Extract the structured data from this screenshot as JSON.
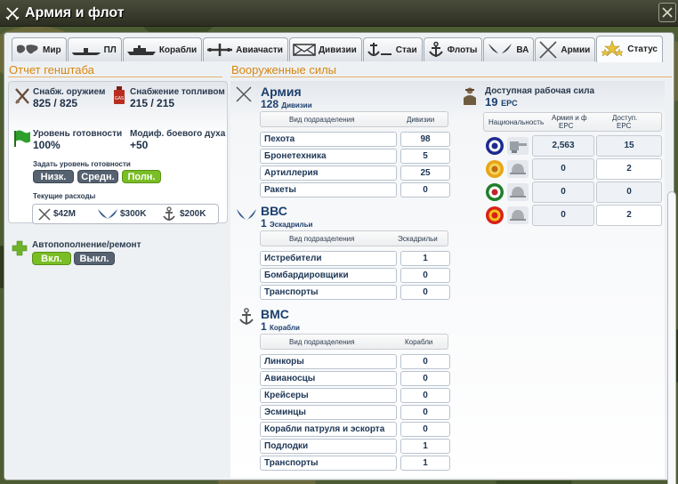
{
  "window": {
    "title": "Армия и флот",
    "close_icon": "close-icon"
  },
  "tabs": [
    {
      "label": "Мир",
      "icon": "world-map-icon"
    },
    {
      "label": "ПЛ",
      "icon": "submarine-icon"
    },
    {
      "label": "Корабли",
      "icon": "warship-icon"
    },
    {
      "label": "Авиачасти",
      "icon": "airplane-icon"
    },
    {
      "label": "Дивизии",
      "icon": "envelope-icon"
    },
    {
      "label": "Стаи",
      "icon": "anchor-fleet-icon"
    },
    {
      "label": "Флоты",
      "icon": "anchor-icon"
    },
    {
      "label": "ВА",
      "icon": "wings-icon"
    },
    {
      "label": "Армии",
      "icon": "crossed-swords-icon"
    },
    {
      "label": "Статус",
      "icon": "stars-icon",
      "active": true
    }
  ],
  "staff": {
    "title": "Отчет генштаба",
    "weapons_label": "Снабж. оружием",
    "weapons_value": "825 / 825",
    "fuel_label": "Снабжение топливом",
    "fuel_value": "215 / 215",
    "readiness_label": "Уровень готовности",
    "readiness_value": "100%",
    "morale_label": "Модиф. боевого духа",
    "morale_value": "+50",
    "set_readiness_label": "Задать уровень готовности",
    "readiness_buttons": [
      "Низк.",
      "Средн.",
      "Полн."
    ],
    "expenses_label": "Текущие расходы",
    "expenses": [
      {
        "icon": "crossed-swords-icon",
        "value": "$42M"
      },
      {
        "icon": "wings-icon",
        "value": "$300K"
      },
      {
        "icon": "anchor-icon",
        "value": "$200K"
      }
    ],
    "auto_label": "Автопополнение/ремонт",
    "auto_buttons": [
      "Вкл.",
      "Выкл."
    ]
  },
  "forces": {
    "title": "Вооруженные силы",
    "army": {
      "name": "Армия",
      "count": "128",
      "count_unit": "Дивизии",
      "col_type": "Вид подразделения",
      "col_count": "Дивизии",
      "rows": [
        {
          "name": "Пехота",
          "count": "98"
        },
        {
          "name": "Бронетехника",
          "count": "5"
        },
        {
          "name": "Артиллерия",
          "count": "25"
        },
        {
          "name": "Ракеты",
          "count": "0"
        }
      ]
    },
    "air": {
      "name": "ВВС",
      "count": "1",
      "count_unit": "Эскадрильи",
      "col_type": "Вид подразделения",
      "col_count": "Эскадрильи",
      "rows": [
        {
          "name": "Истребители",
          "count": "1"
        },
        {
          "name": "Бомбардировщики",
          "count": "0"
        },
        {
          "name": "Транспорты",
          "count": "0"
        }
      ]
    },
    "navy": {
      "name": "ВМС",
      "count": "1",
      "count_unit": "Корабли",
      "col_type": "Вид подразделения",
      "col_count": "Корабли",
      "rows": [
        {
          "name": "Линкоры",
          "count": "0"
        },
        {
          "name": "Авианосцы",
          "count": "0"
        },
        {
          "name": "Крейсеры",
          "count": "0"
        },
        {
          "name": "Эсминцы",
          "count": "0"
        },
        {
          "name": "Корабли патруля и эскорта",
          "count": "0"
        },
        {
          "name": "Подлодки",
          "count": "1"
        },
        {
          "name": "Транспорты",
          "count": "1"
        }
      ]
    }
  },
  "manpower": {
    "title": "Доступная рабочая сила",
    "value": "19",
    "unit": "EPC",
    "col_nationality": "Национальность",
    "col_army": "Армия и ф",
    "col_army_sub": "EPC",
    "col_avail": "Доступ.",
    "col_avail_sub": "EPC",
    "rows": [
      {
        "flag_colors": [
          "#1c2a8f",
          "#ffffff",
          "#1c2a8f"
        ],
        "army": "2,563",
        "avail": "15",
        "unit_icon": "tank-icon"
      },
      {
        "flag_colors": [
          "#e8a414",
          "#f4d35a",
          "#c06d10"
        ],
        "army": "0",
        "avail": "2",
        "unit_icon": "helmet-icon"
      },
      {
        "flag_colors": [
          "#1f7d2a",
          "#ffffff",
          "#c0232b"
        ],
        "army": "0",
        "avail": "0",
        "unit_icon": "helmet-icon"
      },
      {
        "flag_colors": [
          "#d8201a",
          "#f3c316",
          "#d8201a"
        ],
        "army": "0",
        "avail": "2",
        "unit_icon": "helmet-icon"
      }
    ]
  }
}
